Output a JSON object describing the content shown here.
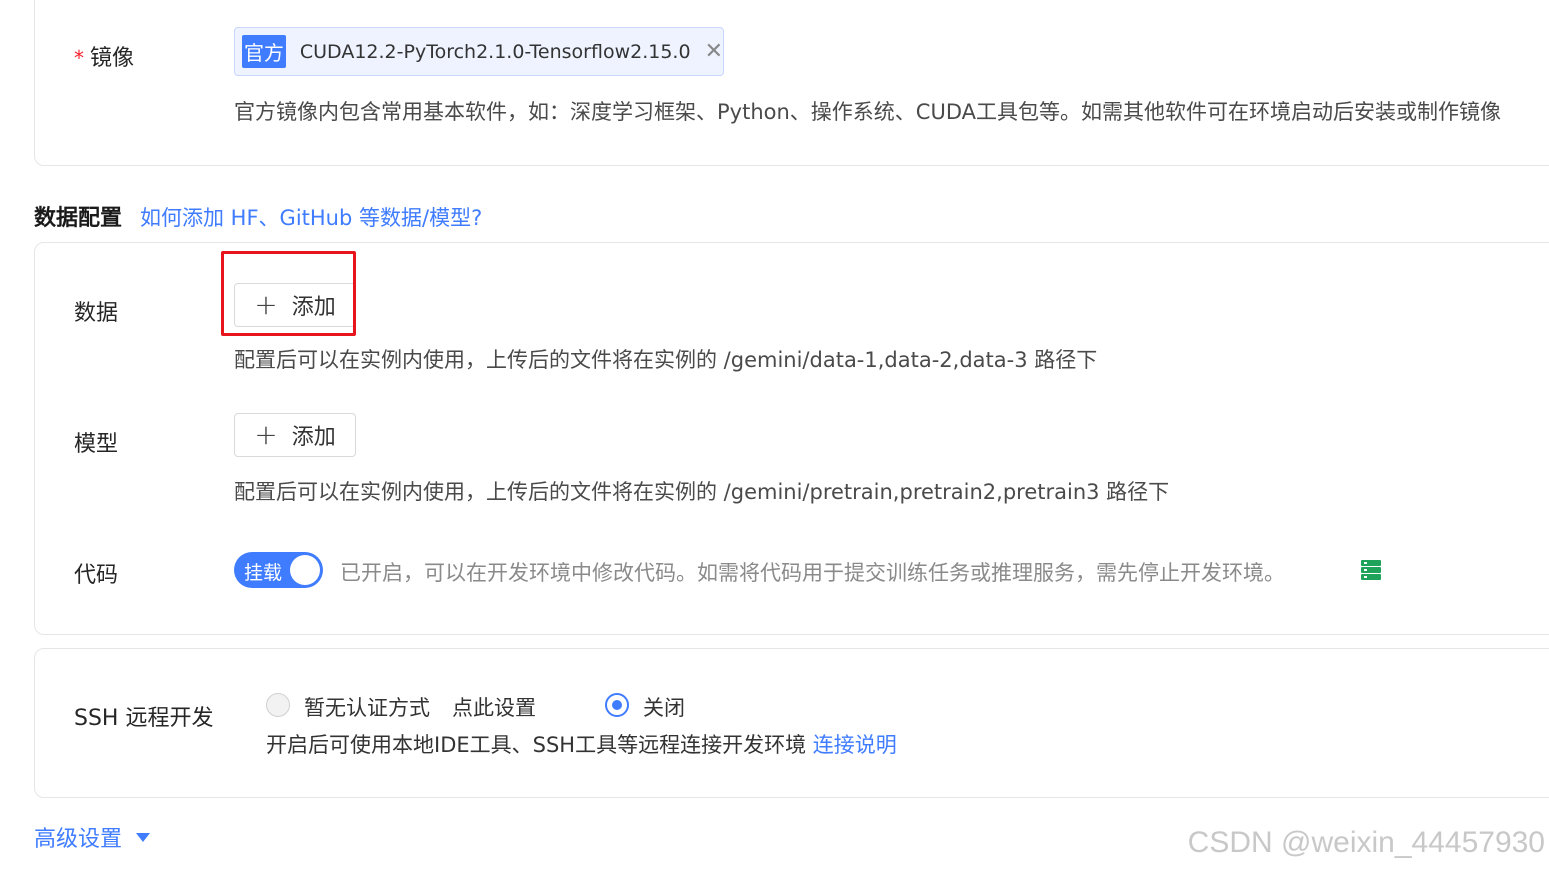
{
  "image": {
    "label": "镜像",
    "required_mark": "*",
    "tag_badge": "官方",
    "tag_name": "CUDA12.2-PyTorch2.1.0-Tensorflow2.15.0",
    "close_glyph": "✕",
    "description": "官方镜像内包含常用基本软件，如：深度学习框架、Python、操作系统、CUDA工具包等。如需其他软件可在环境启动后安装或制作镜像"
  },
  "data_config": {
    "title": "数据配置",
    "help_link": "如何添加 HF、GitHub 等数据/模型?",
    "data": {
      "label": "数据",
      "add_label": "添加",
      "plus_glyph": "+",
      "description": "配置后可以在实例内使用，上传后的文件将在实例的 /gemini/data-1,data-2,data-3 路径下"
    },
    "model": {
      "label": "模型",
      "add_label": "添加",
      "plus_glyph": "+",
      "description": "配置后可以在实例内使用，上传后的文件将在实例的 /gemini/pretrain,pretrain2,pretrain3 路径下"
    },
    "code": {
      "label": "代码",
      "switch_label": "挂载",
      "switch_on": true,
      "description": "已开启，可以在开发环境中修改代码。如需将代码用于提交训练任务或推理服务，需先停止开发环境。"
    }
  },
  "ssh": {
    "label": "SSH 远程开发",
    "option_none": "暂无认证方式",
    "setup_link": "点此设置",
    "option_off": "关闭",
    "selected": "关闭",
    "description": "开启后可使用本地IDE工具、SSH工具等远程连接开发环境",
    "doc_link": "连接说明"
  },
  "advanced": {
    "label": "高级设置"
  },
  "watermark": "CSDN @weixin_44457930",
  "colors": {
    "accent": "#3f7cff",
    "required": "#f5222d",
    "highlight": "#e8141b",
    "code_icon": "#1fa35b"
  }
}
